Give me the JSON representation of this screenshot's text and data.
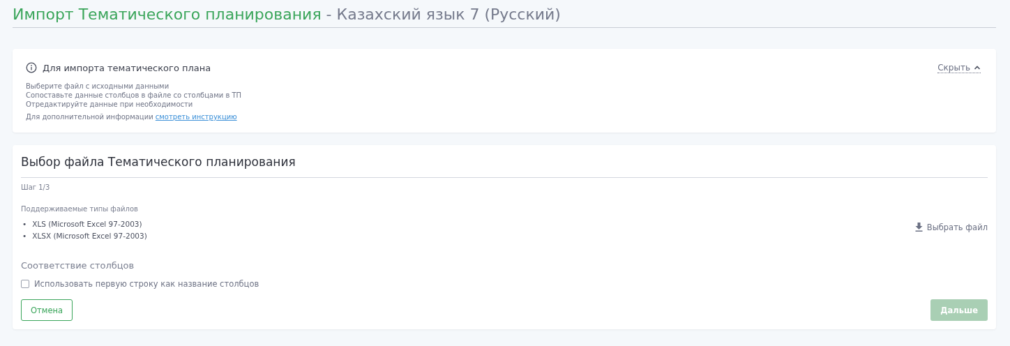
{
  "page_title": {
    "main": "Импорт Тематического планирования",
    "separator": "-",
    "subject": "Казахский язык 7 (Русский)"
  },
  "info": {
    "title": "Для импорта тематического плана",
    "toggle": "Скрыть",
    "expanded": true,
    "steps": [
      "Выберите файл с исходными данными",
      "Сопоставьте данные столбцов в файле со столбцами в ТП",
      "Отредактируйте данные при необходимости"
    ],
    "more_text": "Для дополнительной информации",
    "more_link": "смотреть инструкцию"
  },
  "step_card": {
    "title": "Выбор файла Тематического планирования",
    "step": "Шаг 1/3",
    "types_label": "Поддерживаемые типы файлов",
    "file_types": [
      {
        "marker": "•",
        "name": "XLS (Microsoft Excel 97-2003)"
      },
      {
        "marker": "•",
        "name": "XLSX (Microsoft Excel 97-2003)"
      }
    ],
    "choose_file": "Выбрать файл",
    "mapping_title": "Соответствие столбцов",
    "header_checkbox": {
      "label": "Использовать первую строку как название столбцов",
      "checked": false
    },
    "cancel": "Отмена",
    "next": {
      "label": "Дальше",
      "disabled": true
    }
  }
}
